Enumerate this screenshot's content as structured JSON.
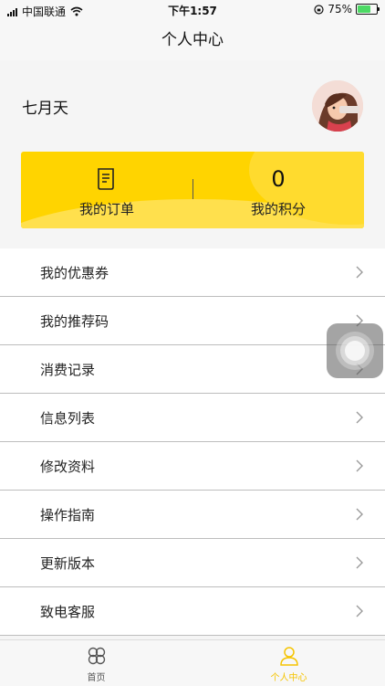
{
  "status_bar": {
    "carrier": "中国联通",
    "time": "下午1:57",
    "battery_percent": "75%",
    "battery_level": 0.75
  },
  "nav": {
    "title": "个人中心"
  },
  "profile": {
    "username": "七月天"
  },
  "stats": {
    "orders_label": "我的订单",
    "points_value": "0",
    "points_label": "我的积分"
  },
  "menu": {
    "items": [
      {
        "label": "我的优惠券"
      },
      {
        "label": "我的推荐码"
      },
      {
        "label": "消费记录"
      },
      {
        "label": "信息列表"
      },
      {
        "label": "修改资料"
      },
      {
        "label": "操作指南"
      },
      {
        "label": "更新版本"
      },
      {
        "label": "致电客服"
      }
    ]
  },
  "tab_bar": {
    "tabs": [
      {
        "label": "首页",
        "icon": "clover-icon",
        "active": false
      },
      {
        "label": "个人中心",
        "icon": "person-icon",
        "active": true
      }
    ]
  },
  "colors": {
    "accent": "#ffd400",
    "active_tab": "#f5c400",
    "inactive_tab": "#555555"
  }
}
